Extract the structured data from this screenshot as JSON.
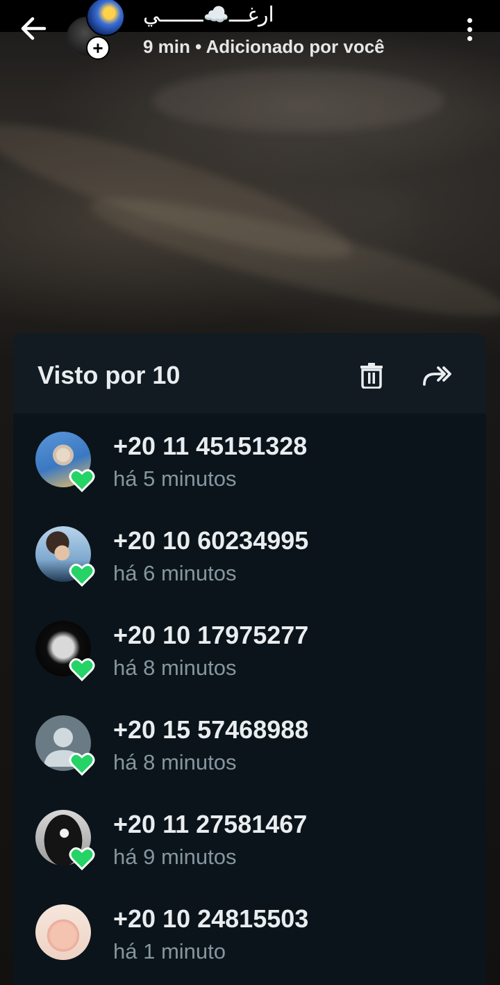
{
  "header": {
    "title": "ارغـــ☁️ـــــــي",
    "subtitle": "9 min • Adicionado por você",
    "back_icon": "arrow-left-icon",
    "menu_icon": "more-vertical-icon",
    "add_icon": "plus-icon"
  },
  "sheet": {
    "title": "Visto por 10",
    "delete_icon": "trash-icon",
    "forward_icon": "forward-icon"
  },
  "viewers": [
    {
      "number": "+20 11 45151328",
      "time": "há 5 minutos",
      "reacted": true,
      "avatar": "photo"
    },
    {
      "number": "+20 10 60234995",
      "time": "há 6 minutos",
      "reacted": true,
      "avatar": "photo"
    },
    {
      "number": "+20 10 17975277",
      "time": "há 8 minutos",
      "reacted": true,
      "avatar": "moon-photo"
    },
    {
      "number": "+20 15 57468988",
      "time": "há 8 minutos",
      "reacted": true,
      "avatar": "default-person"
    },
    {
      "number": "+20 11 27581467",
      "time": "há 9 minutos",
      "reacted": true,
      "avatar": "photo"
    },
    {
      "number": "+20 10 24815503",
      "time": "há 1 minuto",
      "reacted": false,
      "avatar": "baby-photo"
    }
  ],
  "colors": {
    "sheet_bg": "#0b141a",
    "sheet_header_bg": "#111b21",
    "heart": "#25d366",
    "primary_text": "#e9edef",
    "secondary_text": "#8696a0"
  }
}
